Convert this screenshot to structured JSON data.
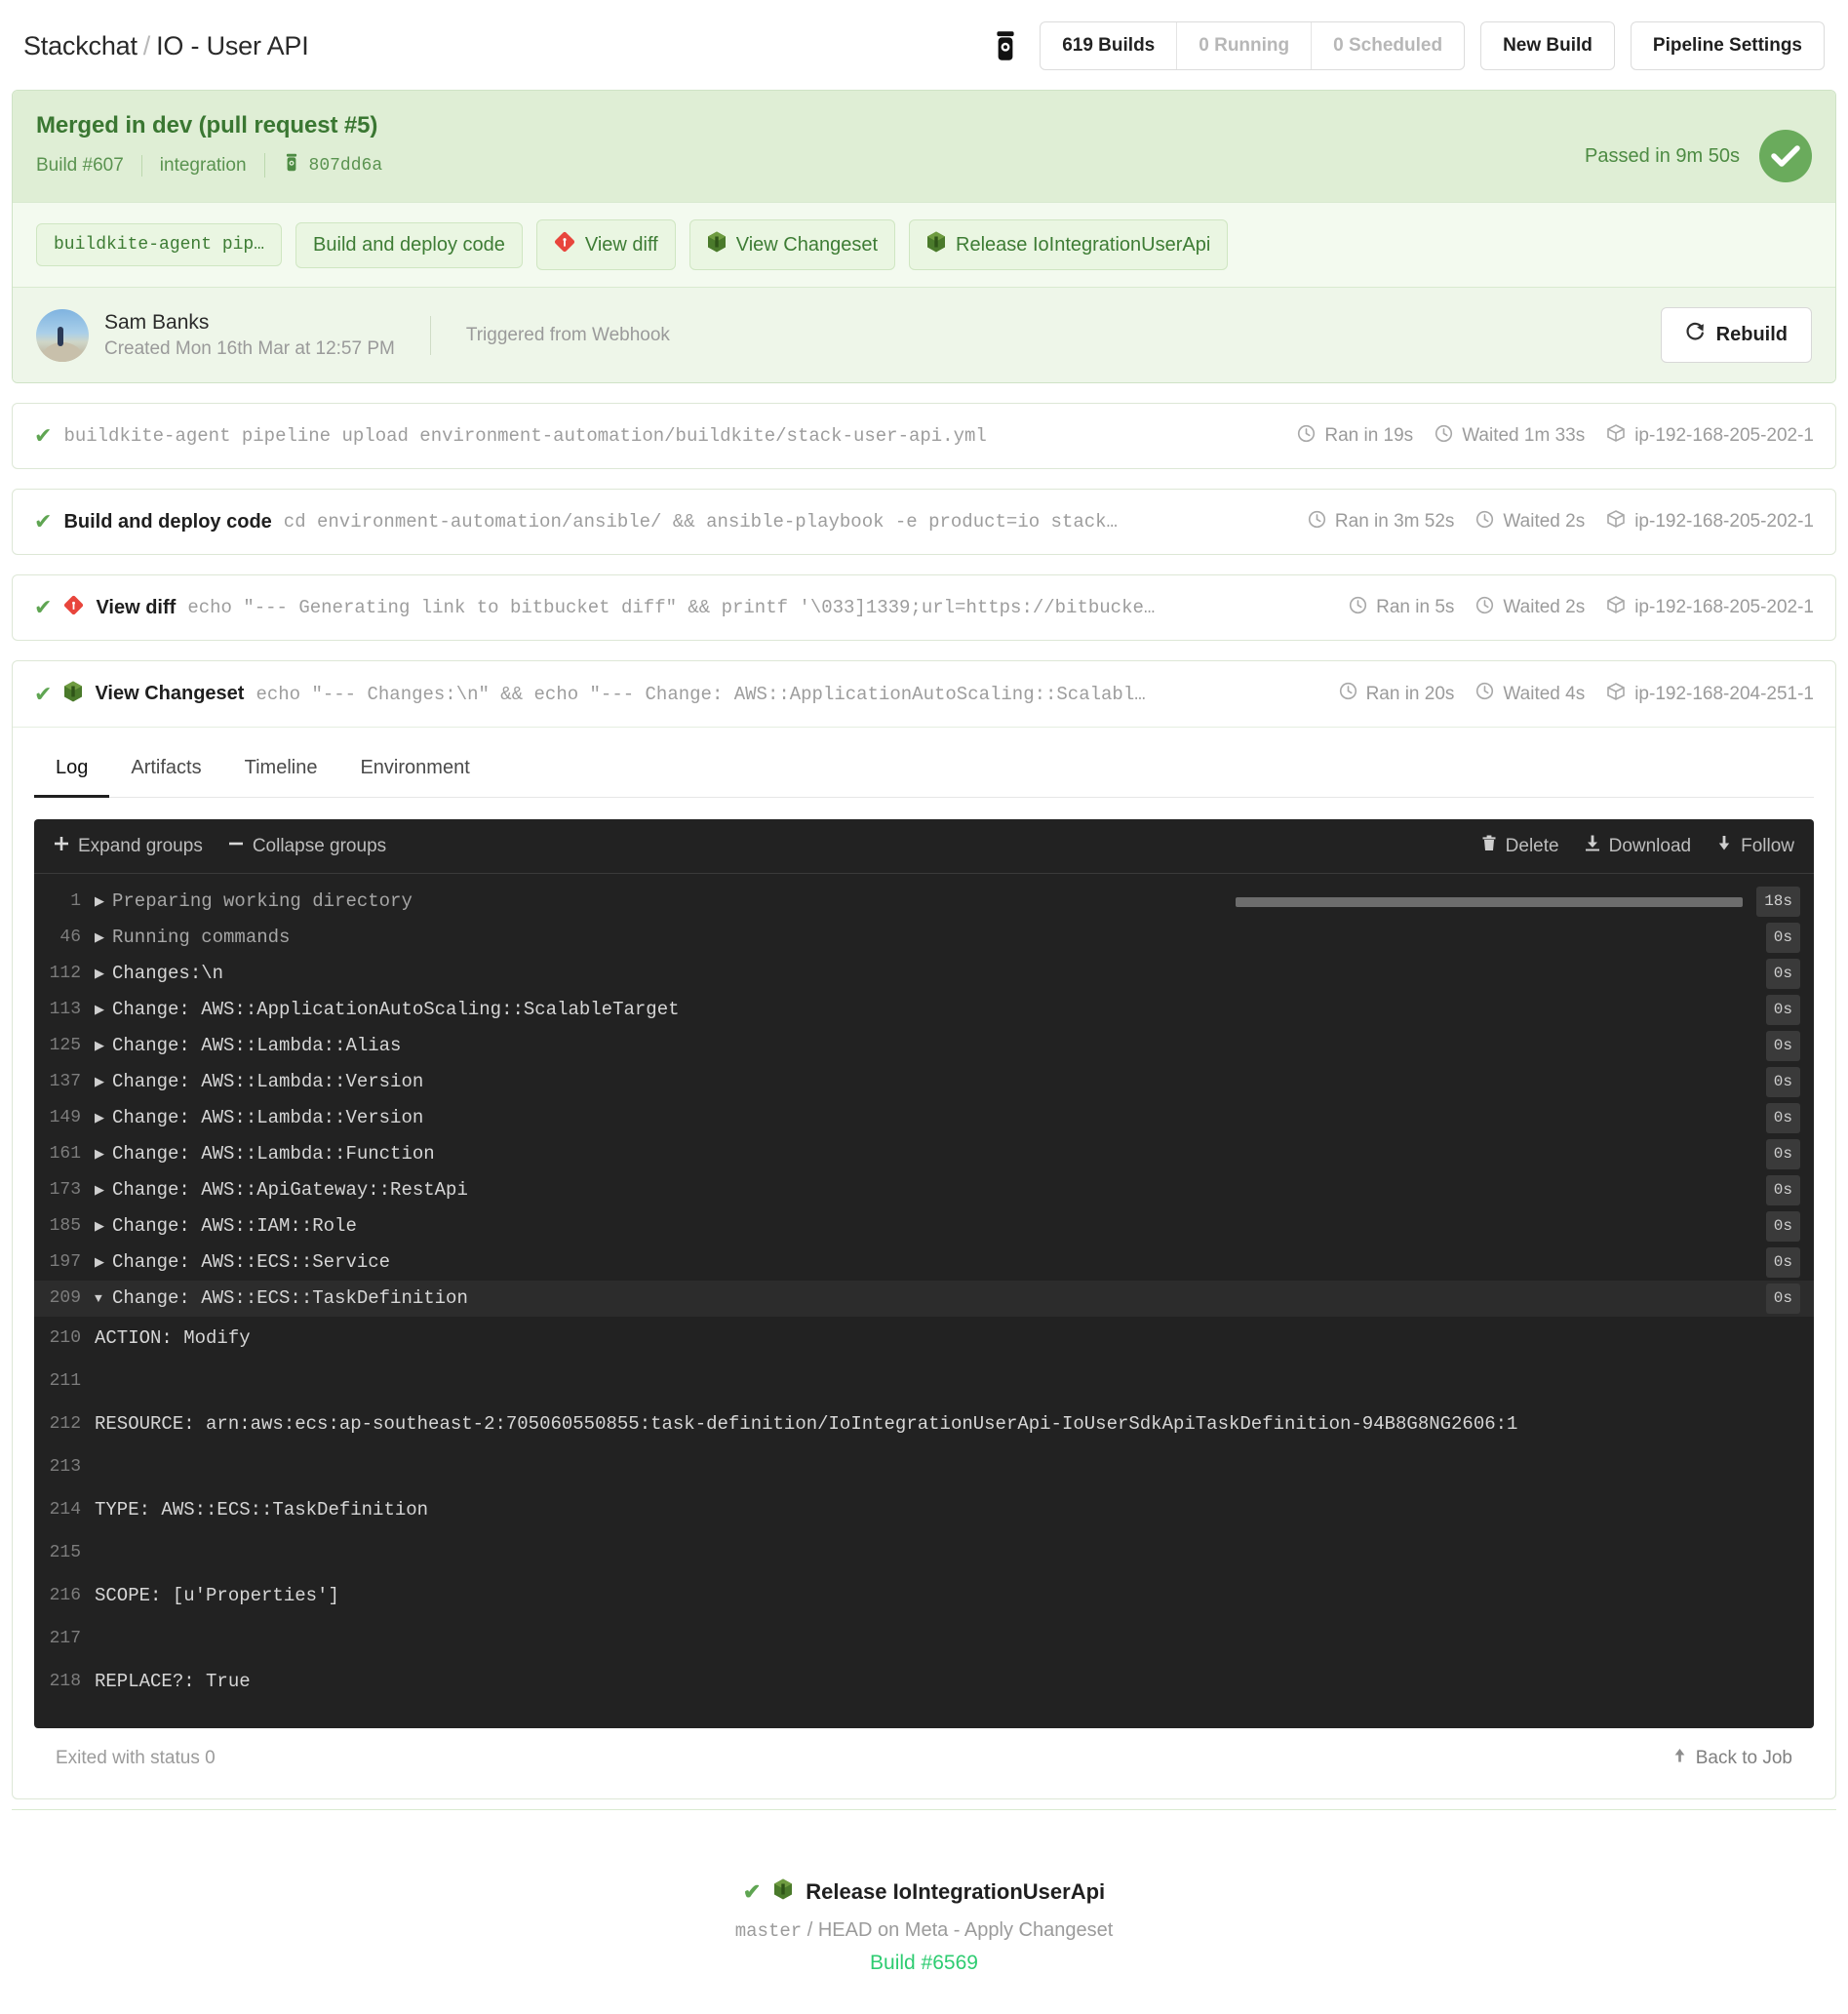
{
  "header": {
    "breadcrumb_org": "Stackchat",
    "breadcrumb_sep": "/",
    "breadcrumb_pipeline": "IO - User API",
    "logo_icon": "buildkite-logo-icon",
    "counters": [
      {
        "label": "619 Builds",
        "muted": false
      },
      {
        "label": "0 Running",
        "muted": true
      },
      {
        "label": "0 Scheduled",
        "muted": true
      }
    ],
    "new_build_label": "New Build",
    "pipeline_settings_label": "Pipeline Settings"
  },
  "build": {
    "title": "Merged in dev (pull request #5)",
    "number": "Build #607",
    "branch": "integration",
    "commit_icon": "buildkite-commit-icon",
    "commit": "807dd6a",
    "status_text": "Passed in 9m 50s",
    "status_icon": "check-icon",
    "pills": [
      {
        "label": "buildkite-agent pip…",
        "icon": null,
        "mono": true
      },
      {
        "label": "Build and deploy code",
        "icon": null,
        "mono": false
      },
      {
        "label": "View diff",
        "icon": "git-diamond-icon",
        "mono": false
      },
      {
        "label": "View Changeset",
        "icon": "cloudformation-cube-icon",
        "mono": false
      },
      {
        "label": "Release IoIntegrationUserApi",
        "icon": "cloudformation-cube-icon",
        "mono": false
      }
    ],
    "creator": {
      "avatar_icon": "user-avatar",
      "name": "Sam Banks",
      "created": "Created Mon 16th Mar at 12:57 PM",
      "trigger": "Triggered from Webhook",
      "rebuild_label": "Rebuild",
      "rebuild_icon": "refresh-icon"
    }
  },
  "jobs": [
    {
      "state_icon": "check-icon",
      "icon": null,
      "label": "",
      "command": "buildkite-agent pipeline upload environment-automation/buildkite/stack-user-api.yml",
      "ran": "Ran in 19s",
      "waited": "Waited 1m 33s",
      "agent": "ip-192-168-205-202-1"
    },
    {
      "state_icon": "check-icon",
      "icon": null,
      "label": "Build and deploy code",
      "command": "cd environment-automation/ansible/ && ansible-playbook -e product=io stack…",
      "ran": "Ran in 3m 52s",
      "waited": "Waited 2s",
      "agent": "ip-192-168-205-202-1"
    },
    {
      "state_icon": "check-icon",
      "icon": "git-diamond-icon",
      "label": "View diff",
      "command": "echo \"--- Generating link to bitbucket diff\" && printf '\\033]1339;url=https://bitbucke…",
      "ran": "Ran in 5s",
      "waited": "Waited 2s",
      "agent": "ip-192-168-205-202-1"
    }
  ],
  "selected_job": {
    "state_icon": "check-icon",
    "icon": "cloudformation-cube-icon",
    "label": "View Changeset",
    "command": "echo \"--- Changes:\\n\" && echo \"--- Change: AWS::ApplicationAutoScaling::Scalabl…",
    "ran": "Ran in 20s",
    "waited": "Waited 4s",
    "agent": "ip-192-168-204-251-1",
    "tabs": [
      {
        "label": "Log",
        "active": true
      },
      {
        "label": "Artifacts",
        "active": false
      },
      {
        "label": "Timeline",
        "active": false
      },
      {
        "label": "Environment",
        "active": false
      }
    ],
    "log_toolbar": {
      "expand_label": "Expand groups",
      "expand_icon": "plus-icon",
      "collapse_label": "Collapse groups",
      "collapse_icon": "minus-icon",
      "delete_label": "Delete",
      "delete_icon": "trash-icon",
      "download_label": "Download",
      "download_icon": "download-icon",
      "follow_label": "Follow",
      "follow_icon": "arrow-down-icon"
    },
    "log_groups": [
      {
        "line": "1",
        "text": "Preparing working directory",
        "duration": "18s",
        "expanded": false,
        "bar": true,
        "dim": true
      },
      {
        "line": "46",
        "text": "Running commands",
        "duration": "0s",
        "expanded": false,
        "bar": false,
        "dim": true
      },
      {
        "line": "112",
        "text": "Changes:\\n",
        "duration": "0s",
        "expanded": false,
        "bar": false,
        "dim": false
      },
      {
        "line": "113",
        "text": "Change: AWS::ApplicationAutoScaling::ScalableTarget",
        "duration": "0s",
        "expanded": false,
        "bar": false,
        "dim": false
      },
      {
        "line": "125",
        "text": "Change: AWS::Lambda::Alias",
        "duration": "0s",
        "expanded": false,
        "bar": false,
        "dim": false
      },
      {
        "line": "137",
        "text": "Change: AWS::Lambda::Version",
        "duration": "0s",
        "expanded": false,
        "bar": false,
        "dim": false
      },
      {
        "line": "149",
        "text": "Change: AWS::Lambda::Version",
        "duration": "0s",
        "expanded": false,
        "bar": false,
        "dim": false
      },
      {
        "line": "161",
        "text": "Change: AWS::Lambda::Function",
        "duration": "0s",
        "expanded": false,
        "bar": false,
        "dim": false
      },
      {
        "line": "173",
        "text": "Change: AWS::ApiGateway::RestApi",
        "duration": "0s",
        "expanded": false,
        "bar": false,
        "dim": false
      },
      {
        "line": "185",
        "text": "Change: AWS::IAM::Role",
        "duration": "0s",
        "expanded": false,
        "bar": false,
        "dim": false
      },
      {
        "line": "197",
        "text": "Change: AWS::ECS::Service",
        "duration": "0s",
        "expanded": false,
        "bar": false,
        "dim": false
      },
      {
        "line": "209",
        "text": "Change: AWS::ECS::TaskDefinition",
        "duration": "0s",
        "expanded": true,
        "bar": false,
        "dim": false
      }
    ],
    "log_output": [
      {
        "line": "210",
        "text": "ACTION: Modify"
      },
      {
        "line": "211",
        "text": ""
      },
      {
        "line": "212",
        "text": "RESOURCE: arn:aws:ecs:ap-southeast-2:705060550855:task-definition/IoIntegrationUserApi-IoUserSdkApiTaskDefinition-94B8G8NG2606:1"
      },
      {
        "line": "213",
        "text": ""
      },
      {
        "line": "214",
        "text": "TYPE: AWS::ECS::TaskDefinition"
      },
      {
        "line": "215",
        "text": ""
      },
      {
        "line": "216",
        "text": "SCOPE: [u'Properties']"
      },
      {
        "line": "217",
        "text": ""
      },
      {
        "line": "218",
        "text": "REPLACE?: True"
      }
    ],
    "exit_status": "Exited with status 0",
    "back_to_job": "Back to Job",
    "back_to_job_icon": "arrow-up-icon"
  },
  "footer_job": {
    "state_icon": "check-icon",
    "icon": "cloudformation-cube-icon",
    "title": "Release IoIntegrationUserApi",
    "branch": "master",
    "sep": "/",
    "ref": "HEAD",
    "on_text": "on Meta - Apply Changeset",
    "build_link": "Build #6569"
  },
  "colors": {
    "pass_green": "#6aab5c",
    "panel_green_bg": "#dfeed5",
    "link_green": "#2ecc71",
    "log_bg": "#222222"
  }
}
